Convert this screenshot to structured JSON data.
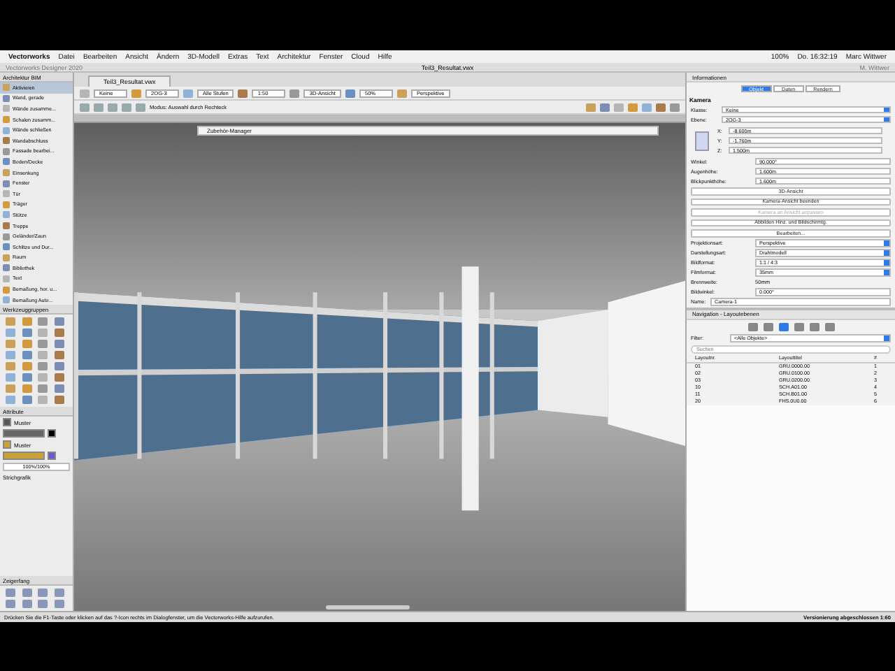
{
  "menu_bar": {
    "app": "Vectorworks",
    "items": [
      "Datei",
      "Bearbeiten",
      "Ansicht",
      "Ändern",
      "3D-Modell",
      "Extras",
      "Text",
      "Architektur",
      "Fenster",
      "Cloud",
      "Hilfe"
    ],
    "zoom": "100%",
    "clock": "Do. 16:32:19",
    "user": "Marc Wittwer"
  },
  "window": {
    "title": "Teil3_Resultat.vwx",
    "palette_title": "Vectorworks Designer 2020",
    "user": "M. Wittwer"
  },
  "document_tab": {
    "label": "Teil3_Resultat.vwx"
  },
  "toolbar": {
    "fields": [
      "Keine",
      "2OG-3",
      "Alle Stufen",
      "1:50",
      "3D-Ansicht",
      "50%",
      "Perspektive"
    ],
    "mode_hint": "Modus: Auswahl durch Rechteck"
  },
  "viewport": {
    "overlay": "Zubehör-Manager"
  },
  "left_palette": {
    "title": "Architektur BIM",
    "items": [
      {
        "label": "Aktivieren",
        "selected": true
      },
      {
        "label": "Wand, gerade",
        "selected": false
      },
      {
        "label": "Wände zusamme...",
        "selected": false
      },
      {
        "label": "Schalen zusamm...",
        "selected": false
      },
      {
        "label": "Wände schließen",
        "selected": false
      },
      {
        "label": "Wandabschluss",
        "selected": false
      },
      {
        "label": "Fassade bearbei...",
        "selected": false
      },
      {
        "label": "Boden/Decke",
        "selected": false
      },
      {
        "label": "Einsenkung",
        "selected": false
      },
      {
        "label": "Fenster",
        "selected": false
      },
      {
        "label": "Tür",
        "selected": false
      },
      {
        "label": "Träger",
        "selected": false
      },
      {
        "label": "Stütze",
        "selected": false
      },
      {
        "label": "Treppe",
        "selected": false
      },
      {
        "label": "Geländer/Zaun",
        "selected": false
      },
      {
        "label": "Schlitze und Dur...",
        "selected": false
      },
      {
        "label": "Raum",
        "selected": false
      },
      {
        "label": "Bibliothek",
        "selected": false
      },
      {
        "label": "Text",
        "selected": false
      },
      {
        "label": "Bemaßung, hor. u...",
        "selected": false
      },
      {
        "label": "Bemaßung Auto...",
        "selected": false
      }
    ]
  },
  "tool_sets": {
    "title": "Werkzeuggruppen"
  },
  "attributes": {
    "title": "Attribute",
    "fill_label": "Muster",
    "line_label": "Muster",
    "opacity": "100%/100%",
    "line_style": "Strichgrafik"
  },
  "snapping": {
    "title": "Zeigerfang"
  },
  "info_palette": {
    "title": "Informationen",
    "tabs": [
      {
        "label": "Objekt",
        "selected": true
      },
      {
        "label": "Daten",
        "selected": false
      },
      {
        "label": "Rendern",
        "selected": false
      }
    ],
    "section": "Kamera",
    "selects": [
      {
        "label": "Klasse:",
        "value": "Keine"
      },
      {
        "label": "Ebene:",
        "value": "2OG-3"
      }
    ],
    "coords": [
      {
        "label": "X:",
        "value": "-8.600m"
      },
      {
        "label": "Y:",
        "value": "-1.760m"
      },
      {
        "label": "Z:",
        "value": "1.500m"
      }
    ],
    "fields": [
      {
        "label": "Winkel:",
        "value": "90.000°"
      },
      {
        "label": "Augenhöhe:",
        "value": "1.600m"
      },
      {
        "label": "Blickpunkthöhe:",
        "value": "1.600m"
      }
    ],
    "buttons": [
      {
        "label": "3D-Ansicht",
        "disabled": false
      },
      {
        "label": "Kamera-Ansicht beenden",
        "disabled": false
      },
      {
        "label": "Kamera an Ansicht anpassen",
        "disabled": true
      },
      {
        "label": "Abbilden Hinz. und Bildschirmtg.",
        "disabled": false
      },
      {
        "label": "Bearbeiten...",
        "disabled": false
      }
    ],
    "options": [
      {
        "label": "Projektionsart:",
        "value": "Perspektive",
        "kind": "select"
      },
      {
        "label": "Darstellungsart:",
        "value": "Drahtmodell",
        "kind": "select"
      },
      {
        "label": "Bildformat:",
        "value": "1:1 / 4:3",
        "kind": "select"
      },
      {
        "label": "Filmformat:",
        "value": "35mm",
        "kind": "select"
      },
      {
        "label": "Brennweite:",
        "value": "50mm",
        "kind": "text"
      },
      {
        "label": "Bildwinkel:",
        "value": "0.000°",
        "kind": "field"
      }
    ],
    "name_label": "Name:",
    "name_value": "Camera-1"
  },
  "navigation": {
    "title": "Navigation - Layoutebenen",
    "filter_label": "Filter:",
    "filter_value": "<Alle Objekte>",
    "search_placeholder": "Suchen",
    "columns": [
      "Layoutnr.",
      "Layouttitel",
      "#"
    ],
    "rows": [
      [
        "01",
        "GRU.0000.00",
        "1"
      ],
      [
        "02",
        "GRU.0100.00",
        "2"
      ],
      [
        "03",
        "GRU.0200.00",
        "3"
      ],
      [
        "10",
        "SCH.A01.00",
        "4"
      ],
      [
        "11",
        "SCH.B01.00",
        "5"
      ],
      [
        "20",
        "FHS.0U0.00",
        "6"
      ]
    ]
  },
  "status_bar": {
    "hint": "Drücken Sie die F1-Taste oder klicken auf das ?-Icon rechts im Dialogfenster, um die Vectorworks-Hilfe aufzurufen.",
    "message": "Versionierung abgeschlossen 1:60"
  }
}
